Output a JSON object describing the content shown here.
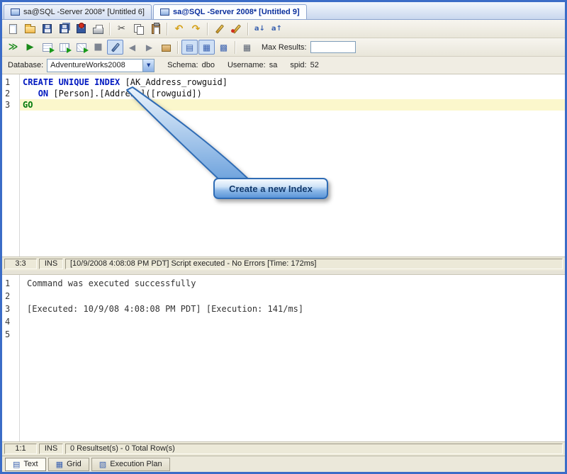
{
  "window": {
    "tabs": [
      {
        "label": "sa@SQL -Server 2008* [Untitled 6]",
        "active": false
      },
      {
        "label": "sa@SQL -Server 2008* [Untitled 9]",
        "active": true
      }
    ]
  },
  "icons": {
    "cut": "✂",
    "undo": "↶",
    "redo": "↷",
    "sort_asc": "a↓",
    "sort_desc": "a↑",
    "execute_all": "≫",
    "execute": "▶",
    "stop": "■",
    "back": "◀",
    "forward": "▶",
    "text_results": "▤",
    "grid_results": "▦",
    "pivot": "▩",
    "options": "▦",
    "combo_arrow": "▼",
    "text_tab": "▤",
    "grid_tab": "▦",
    "plan_tab": "▧"
  },
  "toolbar_exec": {
    "max_results_label": "Max Results:",
    "max_results_value": ""
  },
  "connection": {
    "database_label": "Database:",
    "database_value": "AdventureWorks2008",
    "schema_label": "Schema:",
    "schema_value": "dbo",
    "username_label": "Username:",
    "username_value": "sa",
    "spid_label": "spid:",
    "spid_value": "52"
  },
  "editor": {
    "line_numbers": [
      "1",
      "2",
      "3"
    ],
    "lines": [
      {
        "indent": "",
        "keyword": "CREATE UNIQUE INDEX",
        "code": " [AK_Address_rowguid]"
      },
      {
        "indent": "   ",
        "keyword": "ON",
        "code": " [Person].[Address]([rowguid])"
      },
      {
        "indent": "",
        "keyword": "GO",
        "code": ""
      }
    ]
  },
  "callout": {
    "text": "Create a new Index"
  },
  "editor_status": {
    "cursor": "3:3",
    "mode": "INS",
    "message": "[10/9/2008 4:08:08 PM PDT] Script executed - No Errors [Time: 172ms]"
  },
  "results": {
    "line_numbers": [
      "1",
      "2",
      "3",
      "4",
      "5"
    ],
    "lines": [
      "Command was executed successfully",
      "",
      "[Executed: 10/9/08 4:08:08 PM PDT] [Execution: 141/ms]",
      "",
      ""
    ]
  },
  "results_status": {
    "cursor": "1:1",
    "mode": "INS",
    "message": "0 Resultset(s) - 0 Total Row(s)"
  },
  "bottom_tabs": [
    {
      "label": "Text"
    },
    {
      "label": "Grid"
    },
    {
      "label": "Execution Plan"
    }
  ]
}
